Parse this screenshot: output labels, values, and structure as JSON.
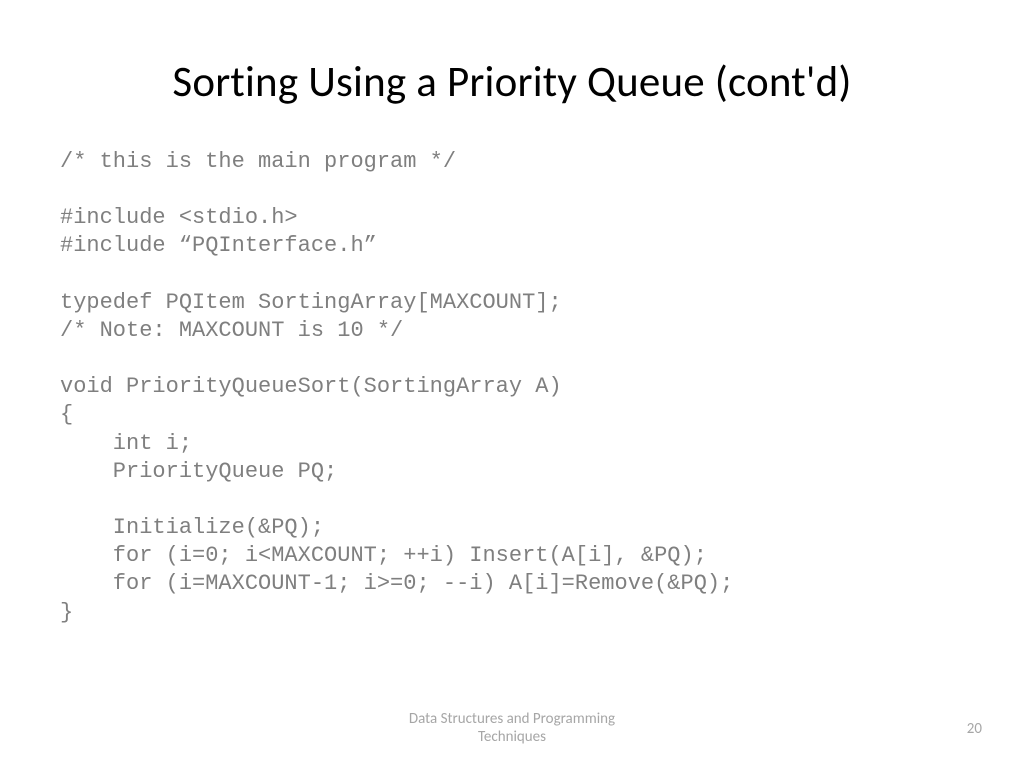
{
  "title": "Sorting Using a Priority Queue (cont'd)",
  "code": "/* this is the main program */\n\n#include <stdio.h>\n#include “PQInterface.h”\n\ntypedef PQItem SortingArray[MAXCOUNT];\n/* Note: MAXCOUNT is 10 */\n\nvoid PriorityQueueSort(SortingArray A)\n{\n    int i;\n    PriorityQueue PQ;\n\n    Initialize(&PQ);\n    for (i=0; i<MAXCOUNT; ++i) Insert(A[i], &PQ);\n    for (i=MAXCOUNT-1; i>=0; --i) A[i]=Remove(&PQ);\n}",
  "footer": {
    "line1": "Data Structures and Programming",
    "line2": "Techniques"
  },
  "page_number": "20"
}
